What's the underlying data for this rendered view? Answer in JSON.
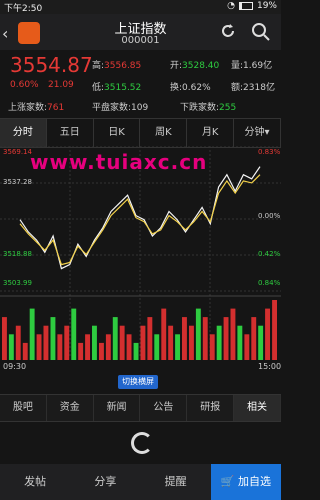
{
  "status_bar": {
    "time": "下午2:50",
    "battery": "19%"
  },
  "header": {
    "title": "上证指数",
    "code": "000001",
    "back_icon": "‹"
  },
  "quote": {
    "price": "3554.87",
    "change_pct": "0.60%",
    "change_amt": "21.09",
    "high_label": "高:",
    "high": "3556.85",
    "open_label": "开:",
    "open": "3528.40",
    "volume_label": "量:",
    "volume": "1.69亿",
    "low_label": "低:",
    "low": "3515.52",
    "turnover_label": "换:",
    "turnover": "0.62%",
    "amount_label": "额:",
    "amount": "2318亿",
    "up_label": "上涨家数:",
    "up_count": "761",
    "flat_label": "平盘家数:",
    "flat_count": "109",
    "down_label": "下跌家数:",
    "down_count": "255"
  },
  "tabs": [
    "分时",
    "五日",
    "日K",
    "周K",
    "月K",
    "分钟▾"
  ],
  "active_tab": 0,
  "watermark": "www.tuiaxc.cn",
  "chart_labels": {
    "left_top": "3569.14",
    "left_mid": "3537.28",
    "left_low": "3518.88",
    "left_bottom": "3503.99",
    "right_top": "0.83%",
    "right_mid": "0.00%",
    "right_low": "0.42%",
    "right_bottom": "0.84%",
    "time_start": "09:30",
    "time_end": "15:00"
  },
  "switch_label": "切换横屏",
  "bottom_tabs": [
    "股吧",
    "资金",
    "新闻",
    "公告",
    "研报",
    "相关"
  ],
  "active_bottom_tab": 5,
  "actions": [
    "发帖",
    "分享",
    "提醒",
    "加自选"
  ],
  "chart_data": {
    "type": "line",
    "title": "",
    "series": [
      {
        "name": "",
        "values": [
          3536,
          3530,
          3526,
          3520,
          3528,
          3512,
          3514,
          3524,
          3518,
          3526,
          3532,
          3540,
          3544,
          3548,
          3538,
          3536,
          3528,
          3532,
          3540,
          3536,
          3530,
          3536,
          3542,
          3534,
          3552,
          3558,
          3550,
          3558,
          3556,
          3562
        ]
      },
      {
        "name": "",
        "values": [
          3534,
          3529,
          3525,
          3521,
          3526,
          3514,
          3515,
          3523,
          3519,
          3525,
          3531,
          3538,
          3542,
          3546,
          3537,
          3535,
          3529,
          3531,
          3538,
          3535,
          3531,
          3535,
          3540,
          3535,
          3549,
          3555,
          3549,
          3555,
          3554,
          3558
        ]
      }
    ],
    "ylim": [
      3503.99,
      3569.14
    ],
    "volume": [
      5,
      3,
      4,
      2,
      6,
      3,
      4,
      5,
      3,
      4,
      6,
      2,
      3,
      4,
      2,
      3,
      5,
      4,
      3,
      2,
      4,
      5,
      3,
      6,
      4,
      3,
      5,
      4,
      6,
      5,
      3,
      4,
      5,
      6,
      4,
      3,
      5,
      4,
      6,
      7
    ]
  }
}
